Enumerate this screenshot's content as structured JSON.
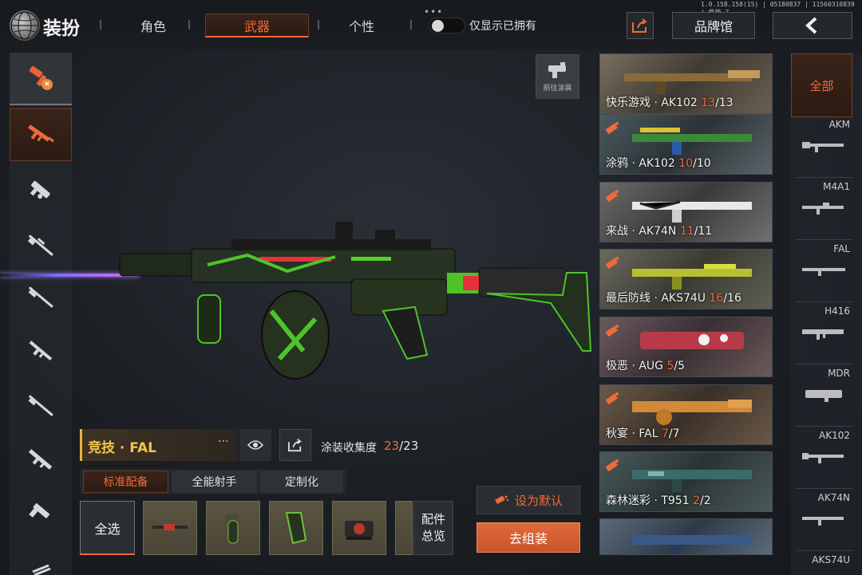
{
  "header": {
    "title": "装扮",
    "tabs": [
      {
        "label": "角色"
      },
      {
        "label": "武器"
      },
      {
        "label": "个性"
      }
    ],
    "toggle_label": "仅显示已拥有",
    "version": "1.0.158.158(15) | 05180837 | 11560310839 | 性能-7",
    "brand_label": "品牌馆"
  },
  "preview": {
    "goto_paint_label": "前往涂装",
    "weapon_name": "竞技 · FAL",
    "more": "···",
    "collection_label": "涂装收集度",
    "collection_current": "23",
    "collection_total": "/23"
  },
  "loadout_tabs": [
    "标准配备",
    "全能射手",
    "定制化"
  ],
  "attachments": {
    "select_all": "全选",
    "overview_line1": "配件",
    "overview_line2": "总览"
  },
  "actions": {
    "set_default": "设为默认",
    "assemble": "去组装"
  },
  "skins": [
    {
      "name": "快乐游戏 · AK102 ",
      "cur": "13",
      "total": "/13"
    },
    {
      "name": "涂鸦 · AK102 ",
      "cur": "10",
      "total": "/10"
    },
    {
      "name": "来战 · AK74N ",
      "cur": "11",
      "total": "/11"
    },
    {
      "name": "最后防线 · AKS74U ",
      "cur": "16",
      "total": "/16"
    },
    {
      "name": "极恶 · AUG ",
      "cur": "5",
      "total": "/5"
    },
    {
      "name": "秋宴 · FAL ",
      "cur": "7",
      "total": "/7"
    },
    {
      "name": "森林迷彩 · T951 ",
      "cur": "2",
      "total": "/2"
    }
  ],
  "weapon_filter": {
    "all_label": "全部",
    "items": [
      "AKM",
      "M4A1",
      "FAL",
      "H416",
      "MDR",
      "AK102",
      "AK74N",
      "AKS74U"
    ]
  },
  "colors": {
    "accent": "#f06a3a",
    "name_gold": "#f5c24a",
    "laser": "#8b6cff"
  }
}
